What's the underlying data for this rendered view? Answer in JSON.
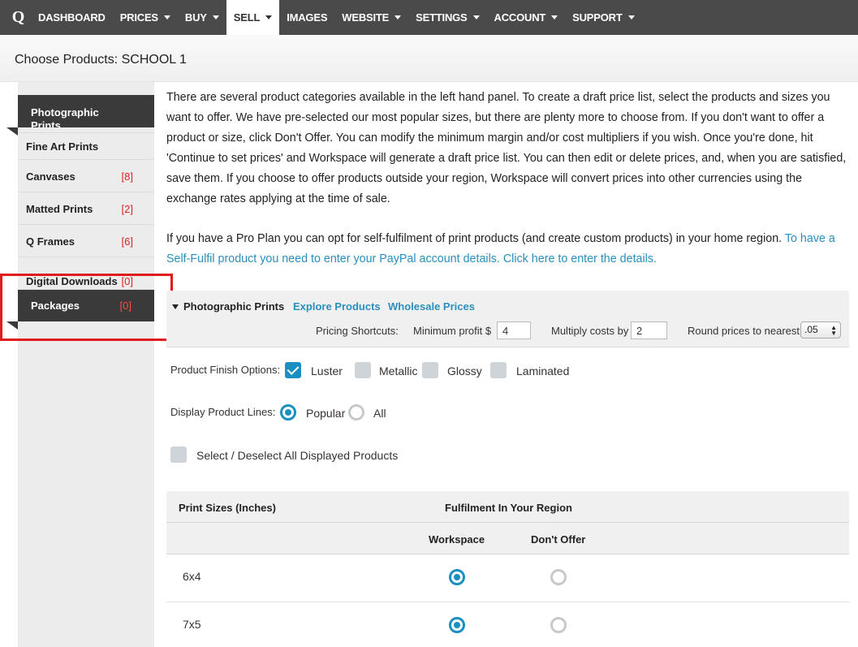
{
  "nav": {
    "logo": "Q",
    "items": [
      {
        "label": "DASHBOARD",
        "caret": false
      },
      {
        "label": "PRICES",
        "caret": true
      },
      {
        "label": "BUY",
        "caret": true
      },
      {
        "label": "SELL",
        "caret": true,
        "active": true
      },
      {
        "label": "IMAGES",
        "caret": false
      },
      {
        "label": "WEBSITE",
        "caret": true
      },
      {
        "label": "SETTINGS",
        "caret": true
      },
      {
        "label": "ACCOUNT",
        "caret": true
      },
      {
        "label": "SUPPORT",
        "caret": true
      }
    ]
  },
  "header": {
    "title": "Choose Products: SCHOOL 1"
  },
  "sidebar": {
    "items": [
      {
        "label": "Photographic Prints",
        "count": ""
      },
      {
        "label": "Fine Art Prints",
        "count": ""
      },
      {
        "label": "Canvases",
        "count": "[8]"
      },
      {
        "label": "Matted Prints",
        "count": "[2]"
      },
      {
        "label": "Q Frames",
        "count": "[6]"
      },
      {
        "label": "Digital Downloads",
        "count": "[0]"
      },
      {
        "label": "Packages",
        "count": "[0]"
      }
    ]
  },
  "intro": {
    "p1": "There are several product categories available in the left hand panel. To create a draft price list, select the products and sizes you want to offer. We have pre-selected our most popular sizes, but there are plenty more to choose from. If you don't want to offer a product or size, click Don't Offer. You can modify the minimum margin and/or cost multipliers if you wish. Once you're done, hit 'Continue to set prices' and Workspace will generate a draft price list. You can then edit or delete prices, and, when you are satisfied, save them. If you choose to offer products outside your region, Workspace will convert prices into other currencies using the exchange rates applying at the time of sale.",
    "p2_text": "If you have a Pro Plan you can opt for self-fulfilment of print products (and create custom products) in your home region. ",
    "p2_link": "To have a Self-Fulfil product you need to enter your PayPal account details. Click here to enter the details."
  },
  "section": {
    "title": "Photographic Prints",
    "explore_link": "Explore Products",
    "wholesale_link": "Wholesale Prices",
    "pricing_shortcuts": "Pricing Shortcuts:",
    "min_profit_label": "Minimum profit $",
    "min_profit_value": "4",
    "multiply_label": "Multiply costs by",
    "multiply_value": "2",
    "round_label": "Round prices to nearest",
    "round_value": ".05"
  },
  "options": {
    "finish_label": "Product Finish Options:",
    "finishes": [
      {
        "label": "Luster",
        "checked": true
      },
      {
        "label": "Metallic",
        "checked": false
      },
      {
        "label": "Glossy",
        "checked": false
      },
      {
        "label": "Laminated",
        "checked": false
      }
    ],
    "lines_label": "Display Product Lines:",
    "lines": [
      {
        "label": "Popular",
        "selected": true
      },
      {
        "label": "All",
        "selected": false
      }
    ],
    "select_all": "Select / Deselect All Displayed Products"
  },
  "table": {
    "col_sizes": "Print Sizes (Inches)",
    "col_region": "Fulfilment In Your Region",
    "col_workspace": "Workspace",
    "col_dont_offer": "Don't Offer",
    "rows": [
      {
        "size": "6x4",
        "workspace": true
      },
      {
        "size": "7x5",
        "workspace": true
      }
    ]
  },
  "colors": {
    "accent": "#1b8fc0",
    "nav_bg": "#4a4a4a",
    "sidebar_dark": "#3a3a3a",
    "count_red": "#e02020",
    "highlight": "#e01b1b"
  }
}
